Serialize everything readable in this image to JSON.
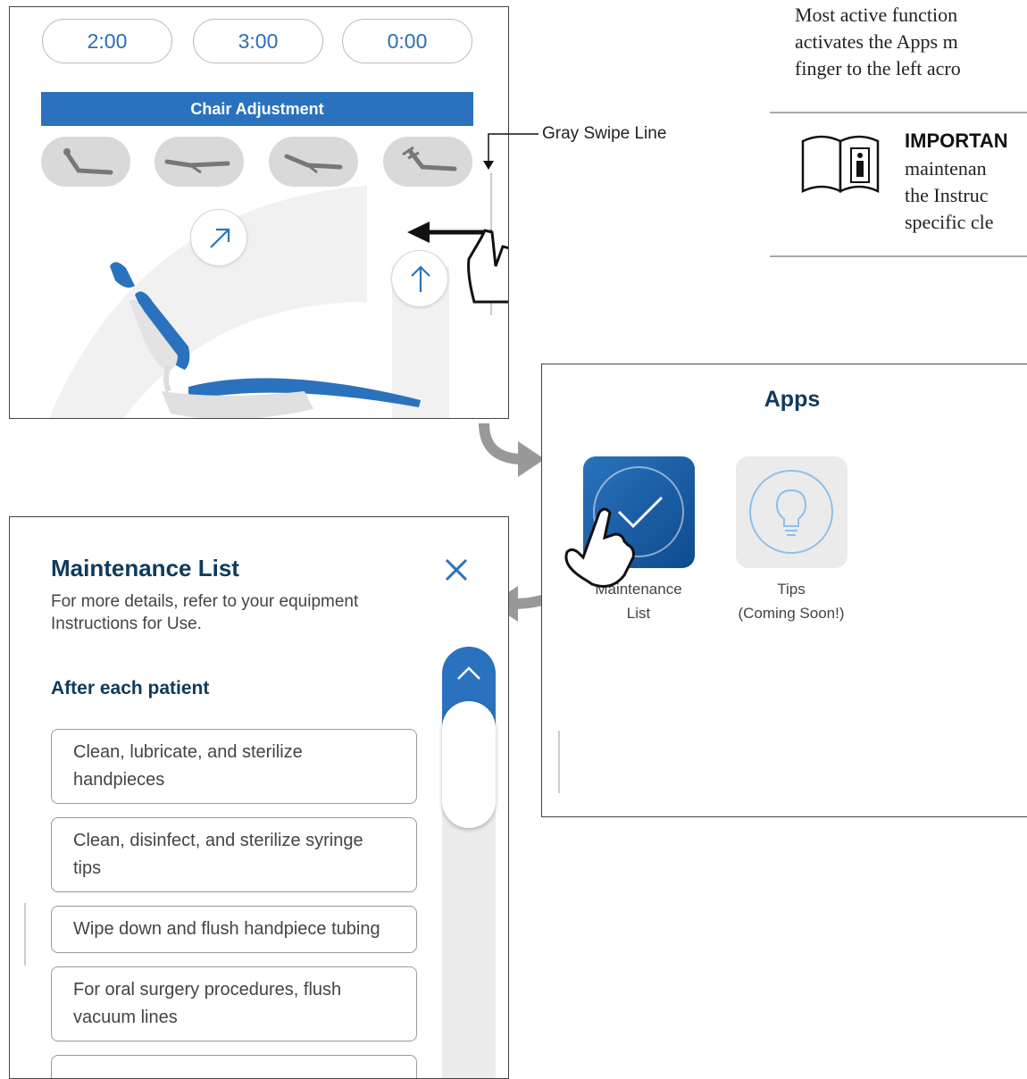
{
  "chair_panel": {
    "timers": [
      "2:00",
      "3:00",
      "0:00"
    ],
    "bar_label": "Chair Adjustment"
  },
  "callout": {
    "label": "Gray Swipe Line"
  },
  "doc_text": {
    "lines": [
      "Most active function",
      "activates the Apps m",
      "finger to the left acro"
    ],
    "important_title": "IMPORTAN",
    "important_lines": [
      "maintenan",
      "the Instruc",
      "specific cle"
    ]
  },
  "apps_panel": {
    "title": "Apps",
    "apps": [
      {
        "label_line1": "Maintenance",
        "label_line2": "List",
        "icon": "checkmark-icon"
      },
      {
        "label_line1": "Tips",
        "label_line2": "(Coming Soon!)",
        "icon": "lightbulb-icon"
      }
    ]
  },
  "maintenance_panel": {
    "title": "Maintenance List",
    "subtitle": "For more details, refer to your equipment Instructions for Use.",
    "section": "After each patient",
    "tasks": [
      "Clean, lubricate, and sterilize handpieces",
      "Clean, disinfect, and sterilize syringe tips",
      "Wipe down and flush handpiece tubing",
      "For oral surgery procedures, flush vacuum lines"
    ]
  },
  "colors": {
    "accent": "#2a72bd",
    "title": "#0f3a5c",
    "pill": "#d9d9d9"
  }
}
